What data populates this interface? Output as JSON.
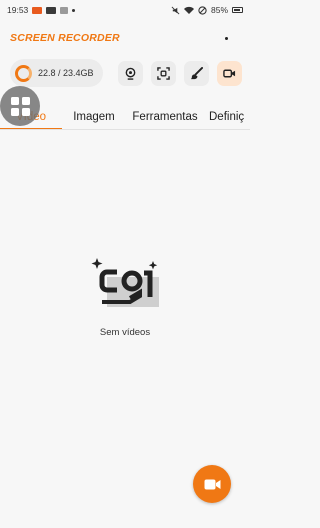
{
  "status_bar": {
    "time": "19:53",
    "battery": "85%",
    "notification_icons": [
      "record-icon",
      "gallery-icon",
      "image-icon"
    ],
    "system_icons": [
      "mute-icon",
      "wifi-icon",
      "no-disturb-icon",
      "battery-icon"
    ]
  },
  "header": {
    "title": "SCREEN RECORDER"
  },
  "toolbar": {
    "storage": "22.8 / 23.4GB",
    "tools": [
      "webcam-icon",
      "screenshot-icon",
      "brush-icon",
      "video-camera-icon"
    ]
  },
  "tabs": [
    {
      "label": "Vídeo",
      "active": true
    },
    {
      "label": "Imagem",
      "active": false
    },
    {
      "label": "Ferramentas",
      "active": false
    },
    {
      "label": "Definiç",
      "active": false
    }
  ],
  "empty_state": {
    "message": "Sem vídeos"
  },
  "colors": {
    "accent": "#f07814",
    "accent_light": "#fde4cf",
    "background": "#f7f7f7"
  }
}
